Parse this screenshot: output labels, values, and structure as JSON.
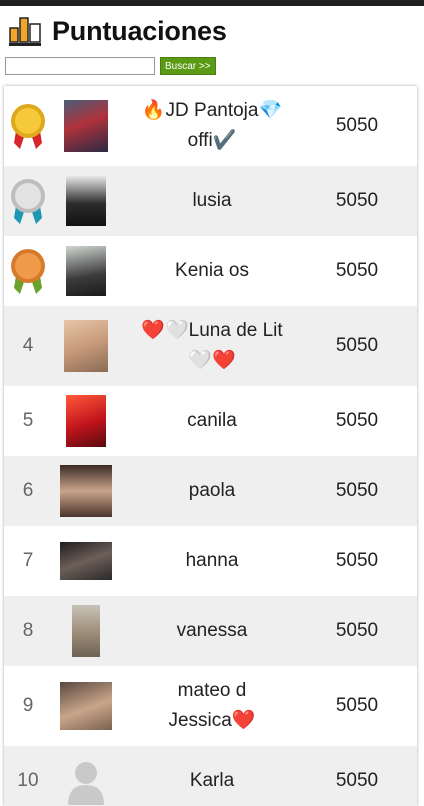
{
  "header": {
    "title": "Puntuaciones"
  },
  "search": {
    "value": "",
    "button_label": "Buscar >>"
  },
  "ranking": [
    {
      "rank": "1",
      "medal": "gold",
      "name_line1": "🔥JD Pantoja💎",
      "name_line2": "offi✔️",
      "score": "5050"
    },
    {
      "rank": "2",
      "medal": "silver",
      "name_line1": "lusia",
      "name_line2": "",
      "score": "5050"
    },
    {
      "rank": "3",
      "medal": "bronze",
      "name_line1": "Kenia os",
      "name_line2": "",
      "score": "5050"
    },
    {
      "rank": "4",
      "medal": "",
      "name_line1": "❤️🤍Luna de Lit",
      "name_line2": "🤍❤️",
      "score": "5050"
    },
    {
      "rank": "5",
      "medal": "",
      "name_line1": "canila",
      "name_line2": "",
      "score": "5050"
    },
    {
      "rank": "6",
      "medal": "",
      "name_line1": "paola",
      "name_line2": "",
      "score": "5050"
    },
    {
      "rank": "7",
      "medal": "",
      "name_line1": "hanna",
      "name_line2": "",
      "score": "5050"
    },
    {
      "rank": "8",
      "medal": "",
      "name_line1": "vanessa",
      "name_line2": "",
      "score": "5050"
    },
    {
      "rank": "9",
      "medal": "",
      "name_line1": "mateo d",
      "name_line2": "Jessica❤️",
      "score": "5050"
    },
    {
      "rank": "10",
      "medal": "",
      "name_line1": "Karla",
      "name_line2": "",
      "score": "5050"
    }
  ],
  "colors": {
    "search_button": "#5b9a14",
    "row_alt": "#efefef",
    "gold": "#f2c12e",
    "silver": "#d6d6d6",
    "bronze": "#e38c3c"
  }
}
